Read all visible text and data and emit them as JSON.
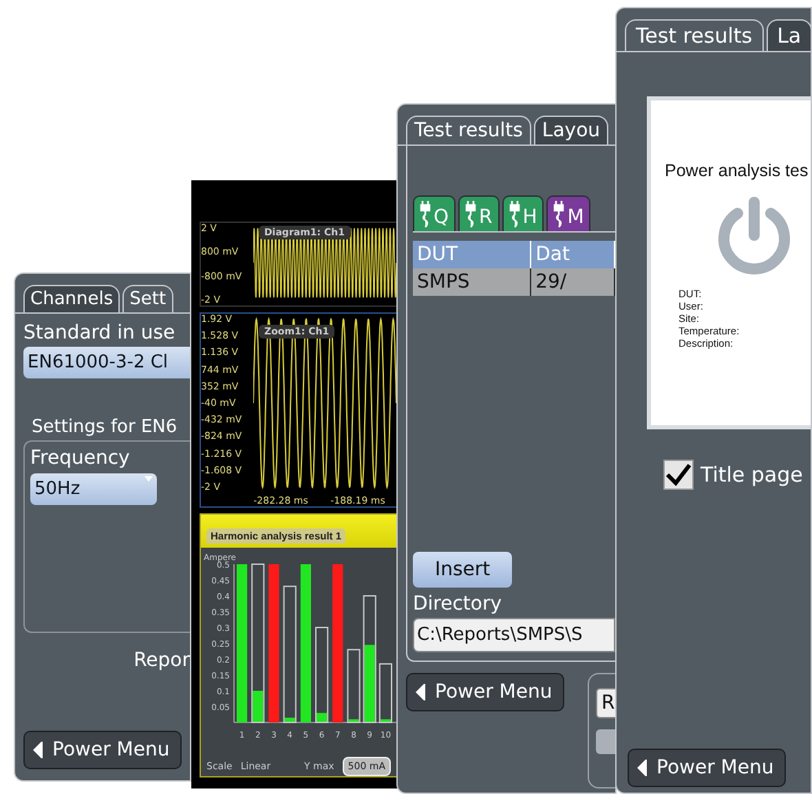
{
  "settings_panel": {
    "tabs": [
      {
        "label": "Channels",
        "selected": false
      },
      {
        "label": "Sett",
        "selected": true
      }
    ],
    "standard_label": "Standard in use",
    "standard_value": "EN61000-3-2 Cl",
    "group_title": "Settings for EN6",
    "frequency_label": "Frequency",
    "frequency_value": "50Hz",
    "report_label": "Repor",
    "menu_button": "Power Menu"
  },
  "scope_panel": {
    "overview": {
      "title": "Diagram1: Ch1",
      "y_labels": [
        "2 V",
        "800 mV",
        "-800 mV",
        "-2 V"
      ]
    },
    "zoom": {
      "title": "Zoom1: Ch1",
      "y_labels": [
        "1.92 V",
        "1.528 V",
        "1.136 V",
        "744 mV",
        "352 mV",
        "-40 mV",
        "-432 mV",
        "-824 mV",
        "-1.216 V",
        "-1.608 V",
        "-2 V"
      ],
      "x_labels": [
        "-282.28 ms",
        "-188.19 ms"
      ]
    },
    "harmonics": {
      "title": "Harmonic analysis result 1",
      "chart_data": {
        "type": "bar",
        "ylabel": "Ampere",
        "categories": [
          "1",
          "2",
          "3",
          "4",
          "5",
          "6",
          "7",
          "8",
          "9",
          "10"
        ],
        "series": [
          {
            "color": "#22e622",
            "values": [
              0.5,
              0.1,
              null,
              0.015,
              0.5,
              0.03,
              null,
              0.01,
              0.245,
              0.01
            ]
          },
          {
            "color": "#ff1a1a",
            "values": [
              null,
              null,
              0.5,
              null,
              null,
              null,
              0.5,
              null,
              null,
              null
            ]
          },
          {
            "color": "#c8c8c8",
            "values": [
              null,
              0.5,
              null,
              0.43,
              null,
              0.3,
              null,
              0.23,
              0.4,
              0.185
            ]
          }
        ],
        "ylim": [
          0,
          0.5
        ],
        "yticks": [
          0.05,
          0.1,
          0.15,
          0.2,
          0.25,
          0.3,
          0.35,
          0.4,
          0.45,
          0.5
        ]
      },
      "scale_label": "Scale",
      "scale_value": "Linear",
      "ymax_label": "Y max",
      "ymax_value": "500 mA"
    }
  },
  "results_panel": {
    "tabs": [
      {
        "label": "Test results",
        "selected": true
      },
      {
        "label": "Layou",
        "selected": false
      }
    ],
    "icon_tabs": [
      {
        "letter": "Q",
        "color": "#2e9b5f"
      },
      {
        "letter": "R",
        "color": "#2e9b5f"
      },
      {
        "letter": "H",
        "color": "#2e9b5f"
      },
      {
        "letter": "M",
        "color": "#7a3a99"
      }
    ],
    "table": {
      "columns": [
        "DUT",
        "Dat"
      ],
      "rows": [
        [
          "SMPS",
          "29/"
        ]
      ]
    },
    "insert_button": "Insert",
    "directory_label": "Directory",
    "directory_value": "C:\\Reports\\SMPS\\S",
    "side_button": "R",
    "menu_button": "Power Menu"
  },
  "report_panel": {
    "tabs": [
      {
        "label": "Test results",
        "selected": true
      },
      {
        "label": "La",
        "selected": false
      }
    ],
    "preview": {
      "title": "Power analysis tes",
      "fields": [
        "DUT:",
        "User:",
        "Site:",
        "Temperature:",
        "Description:"
      ]
    },
    "title_page": {
      "label": "Title page",
      "checked": true
    },
    "menu_button": "Power Menu"
  }
}
